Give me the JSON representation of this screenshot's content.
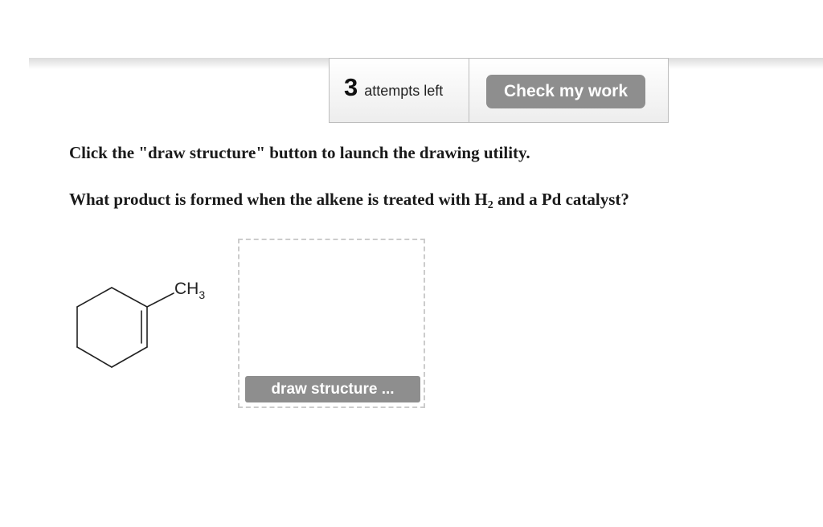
{
  "header": {
    "attempts_count": "3",
    "attempts_label": "attempts left",
    "check_button_label": "Check my work"
  },
  "question": {
    "instruction": "Click the \"draw structure\" button to launch the drawing utility.",
    "prompt_before": "What product is formed when the alkene is treated with H",
    "prompt_subscript": "2",
    "prompt_after": " and a Pd catalyst?"
  },
  "molecule": {
    "substituent_label": "CH",
    "substituent_subscript": "3"
  },
  "draw_area": {
    "button_label": "draw structure ..."
  }
}
